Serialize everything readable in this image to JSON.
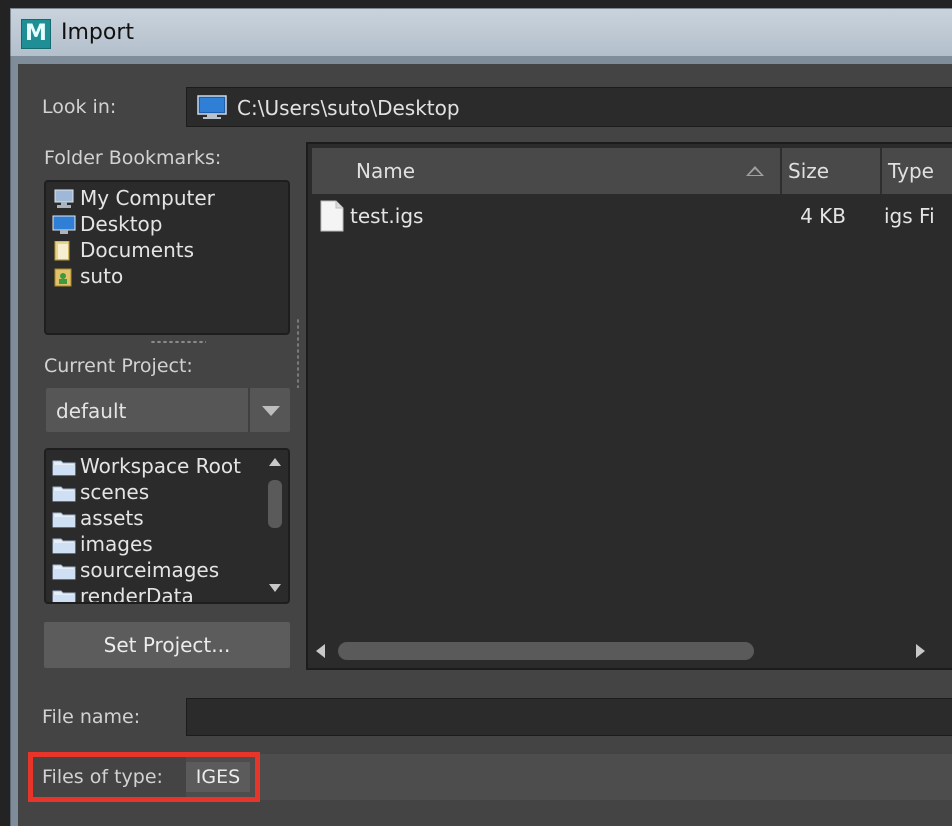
{
  "window": {
    "title": "Import",
    "app_icon_letter": "M"
  },
  "look_in": {
    "label": "Look in:",
    "path": "C:\\Users\\suto\\Desktop",
    "icon": "desktop-monitor-icon"
  },
  "bookmarks": {
    "label": "Folder Bookmarks:",
    "items": [
      {
        "label": "My Computer",
        "icon": "computer-icon"
      },
      {
        "label": "Desktop",
        "icon": "desktop-icon"
      },
      {
        "label": "Documents",
        "icon": "documents-icon"
      },
      {
        "label": "suto",
        "icon": "user-folder-icon"
      }
    ]
  },
  "project": {
    "label": "Current Project:",
    "selected": "default",
    "folders": [
      "Workspace Root",
      "scenes",
      "assets",
      "images",
      "sourceimages",
      "renderData"
    ],
    "set_button": "Set Project..."
  },
  "file_list": {
    "columns": [
      "Name",
      "Size",
      "Type"
    ],
    "sort": "ascending-by-name",
    "rows": [
      {
        "name": "test.igs",
        "size": "4 KB",
        "type": "igs Fi"
      }
    ]
  },
  "file_name": {
    "label": "File name:",
    "value": ""
  },
  "files_of_type": {
    "label": "Files of type:",
    "value": "IGES",
    "highlight_color": "#e8352a"
  }
}
